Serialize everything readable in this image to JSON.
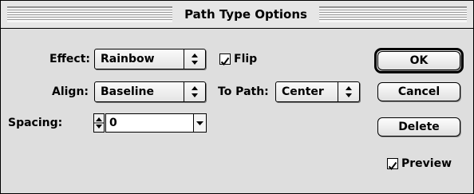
{
  "dialog": {
    "title": "Path Type Options"
  },
  "effect": {
    "label": "Effect:",
    "value": "Rainbow"
  },
  "flip": {
    "label": "Flip",
    "checked": true
  },
  "align": {
    "label": "Align:",
    "value": "Baseline"
  },
  "to_path": {
    "label": "To Path:",
    "value": "Center"
  },
  "spacing": {
    "label": "Spacing:",
    "value": "0"
  },
  "buttons": {
    "ok": "OK",
    "cancel": "Cancel",
    "delete": "Delete"
  },
  "preview": {
    "label": "Preview",
    "checked": true
  },
  "icons": [
    "updown-arrows-icon",
    "checkmark-icon",
    "stepper-arrows-icon",
    "dropdown-arrow-icon"
  ]
}
